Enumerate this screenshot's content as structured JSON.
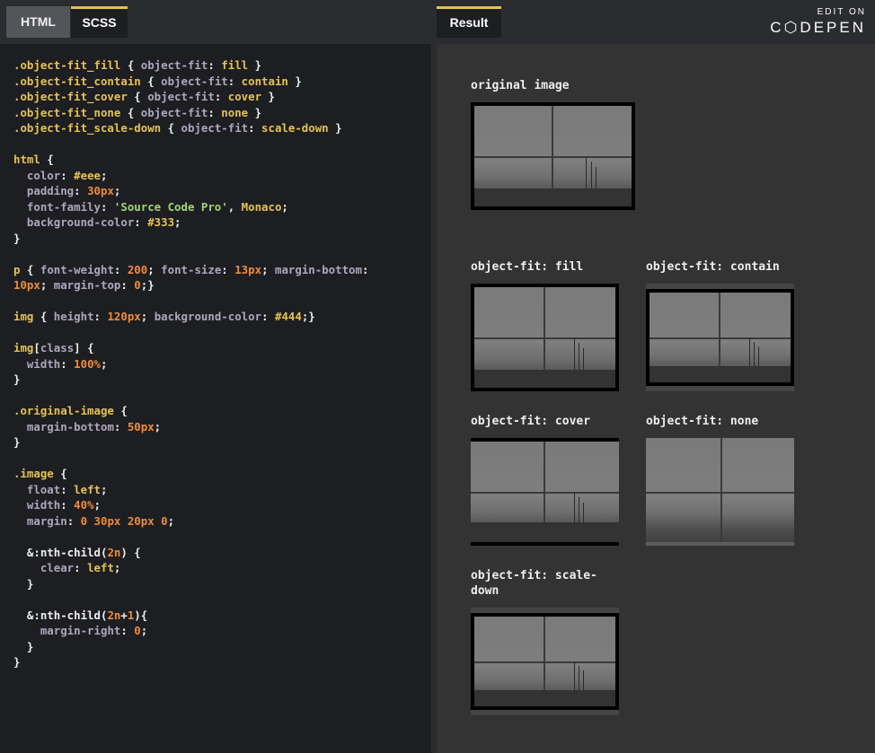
{
  "tabs": {
    "html": "HTML",
    "scss": "SCSS",
    "result": "Result"
  },
  "brand": {
    "edit_on": "EDIT ON",
    "codepen": "C⬡DEPEN"
  },
  "code_lines": [
    [
      [
        "s",
        ".object-fit_fill"
      ],
      [
        "w",
        " { "
      ],
      [
        "p",
        "object-fit"
      ],
      [
        "w",
        ": "
      ],
      [
        "v",
        "fill"
      ],
      [
        "w",
        " }"
      ]
    ],
    [
      [
        "s",
        ".object-fit_contain"
      ],
      [
        "w",
        " { "
      ],
      [
        "p",
        "object-fit"
      ],
      [
        "w",
        ": "
      ],
      [
        "v",
        "contain"
      ],
      [
        "w",
        " }"
      ]
    ],
    [
      [
        "s",
        ".object-fit_cover"
      ],
      [
        "w",
        " { "
      ],
      [
        "p",
        "object-fit"
      ],
      [
        "w",
        ": "
      ],
      [
        "v",
        "cover"
      ],
      [
        "w",
        " }"
      ]
    ],
    [
      [
        "s",
        ".object-fit_none"
      ],
      [
        "w",
        " { "
      ],
      [
        "p",
        "object-fit"
      ],
      [
        "w",
        ": "
      ],
      [
        "v",
        "none"
      ],
      [
        "w",
        " }"
      ]
    ],
    [
      [
        "s",
        ".object-fit_scale-down"
      ],
      [
        "w",
        " { "
      ],
      [
        "p",
        "object-fit"
      ],
      [
        "w",
        ": "
      ],
      [
        "v",
        "scale-down"
      ],
      [
        "w",
        " }"
      ]
    ],
    [],
    [
      [
        "s",
        "html"
      ],
      [
        "w",
        " {"
      ]
    ],
    [
      [
        "w",
        "  "
      ],
      [
        "p",
        "color"
      ],
      [
        "w",
        ": "
      ],
      [
        "v",
        "#eee"
      ],
      [
        "w",
        ";"
      ]
    ],
    [
      [
        "w",
        "  "
      ],
      [
        "p",
        "padding"
      ],
      [
        "w",
        ": "
      ],
      [
        "n",
        "30px"
      ],
      [
        "w",
        ";"
      ]
    ],
    [
      [
        "w",
        "  "
      ],
      [
        "p",
        "font-family"
      ],
      [
        "w",
        ": "
      ],
      [
        "str",
        "'Source Code Pro'"
      ],
      [
        "w",
        ", "
      ],
      [
        "v",
        "Monaco"
      ],
      [
        "w",
        ";"
      ]
    ],
    [
      [
        "w",
        "  "
      ],
      [
        "p",
        "background-color"
      ],
      [
        "w",
        ": "
      ],
      [
        "v",
        "#333"
      ],
      [
        "w",
        ";"
      ]
    ],
    [
      [
        "w",
        "}"
      ]
    ],
    [],
    [
      [
        "s",
        "p"
      ],
      [
        "w",
        " { "
      ],
      [
        "p",
        "font-weight"
      ],
      [
        "w",
        ": "
      ],
      [
        "n",
        "200"
      ],
      [
        "w",
        "; "
      ],
      [
        "p",
        "font-size"
      ],
      [
        "w",
        ": "
      ],
      [
        "n",
        "13px"
      ],
      [
        "w",
        "; "
      ],
      [
        "p",
        "margin-bottom"
      ],
      [
        "w",
        ":"
      ]
    ],
    [
      [
        "n",
        "10px"
      ],
      [
        "w",
        "; "
      ],
      [
        "p",
        "margin-top"
      ],
      [
        "w",
        ": "
      ],
      [
        "n",
        "0"
      ],
      [
        "w",
        ";}"
      ]
    ],
    [],
    [
      [
        "s",
        "img"
      ],
      [
        "w",
        " { "
      ],
      [
        "p",
        "height"
      ],
      [
        "w",
        ": "
      ],
      [
        "n",
        "120px"
      ],
      [
        "w",
        "; "
      ],
      [
        "p",
        "background-color"
      ],
      [
        "w",
        ": "
      ],
      [
        "v",
        "#444"
      ],
      [
        "w",
        ";}"
      ]
    ],
    [],
    [
      [
        "s",
        "img"
      ],
      [
        "w",
        "["
      ],
      [
        "p",
        "class"
      ],
      [
        "w",
        "] {"
      ]
    ],
    [
      [
        "w",
        "  "
      ],
      [
        "p",
        "width"
      ],
      [
        "w",
        ": "
      ],
      [
        "n",
        "100%"
      ],
      [
        "w",
        ";"
      ]
    ],
    [
      [
        "w",
        "}"
      ]
    ],
    [],
    [
      [
        "s",
        ".original-image"
      ],
      [
        "w",
        " {"
      ]
    ],
    [
      [
        "w",
        "  "
      ],
      [
        "p",
        "margin-bottom"
      ],
      [
        "w",
        ": "
      ],
      [
        "n",
        "50px"
      ],
      [
        "w",
        ";"
      ]
    ],
    [
      [
        "w",
        "}"
      ]
    ],
    [],
    [
      [
        "s",
        ".image"
      ],
      [
        "w",
        " {"
      ]
    ],
    [
      [
        "w",
        "  "
      ],
      [
        "p",
        "float"
      ],
      [
        "w",
        ": "
      ],
      [
        "v",
        "left"
      ],
      [
        "w",
        ";"
      ]
    ],
    [
      [
        "w",
        "  "
      ],
      [
        "p",
        "width"
      ],
      [
        "w",
        ": "
      ],
      [
        "n",
        "40%"
      ],
      [
        "w",
        ";"
      ]
    ],
    [
      [
        "w",
        "  "
      ],
      [
        "p",
        "margin"
      ],
      [
        "w",
        ": "
      ],
      [
        "n",
        "0 30px 20px 0"
      ],
      [
        "w",
        ";"
      ]
    ],
    [],
    [
      [
        "w",
        "  &:nth-child("
      ],
      [
        "n",
        "2n"
      ],
      [
        "w",
        ") {"
      ]
    ],
    [
      [
        "w",
        "    "
      ],
      [
        "p",
        "clear"
      ],
      [
        "w",
        ": "
      ],
      [
        "v",
        "left"
      ],
      [
        "w",
        ";"
      ]
    ],
    [
      [
        "w",
        "  }"
      ]
    ],
    [],
    [
      [
        "w",
        "  &:nth-child("
      ],
      [
        "n",
        "2n"
      ],
      [
        "w",
        "+"
      ],
      [
        "n",
        "1"
      ],
      [
        "w",
        "){"
      ]
    ],
    [
      [
        "w",
        "    "
      ],
      [
        "p",
        "margin-right"
      ],
      [
        "w",
        ": "
      ],
      [
        "n",
        "0"
      ],
      [
        "w",
        ";"
      ]
    ],
    [
      [
        "w",
        "  }"
      ]
    ],
    [
      [
        "w",
        "}"
      ]
    ]
  ],
  "result": {
    "original_label": "original image",
    "fill_label": "object-fit: fill",
    "contain_label": "object-fit: contain",
    "cover_label": "object-fit: cover",
    "none_label": "object-fit: none",
    "scale_down_label_1": "object-fit: scale-",
    "scale_down_label_2": "down"
  },
  "colors": {
    "editor_bg": "#1d1e22",
    "topbar_bg": "#2b2c30",
    "result_bg": "#333333",
    "accent": "#e6c352",
    "number": "#f08c3a",
    "property": "#b0a6bd",
    "string": "#a6d37b"
  }
}
